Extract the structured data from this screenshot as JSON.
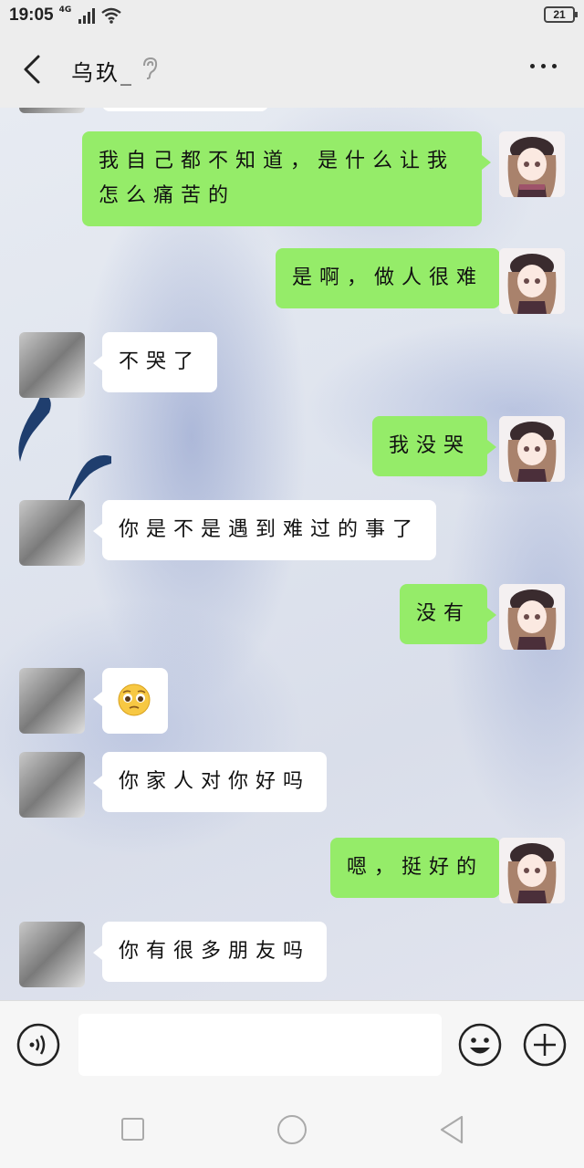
{
  "status_bar": {
    "time": "19:05",
    "network": "4G",
    "battery": "21"
  },
  "header": {
    "title": "乌玖_"
  },
  "messages": [
    {
      "sender": "self",
      "text": "我自己都不知道，是什么让我怎么痛苦的"
    },
    {
      "sender": "self",
      "text": "是啊，做人很难"
    },
    {
      "sender": "other",
      "text": "不哭了"
    },
    {
      "sender": "self",
      "text": "我没哭"
    },
    {
      "sender": "other",
      "text": "你是不是遇到难过的事了"
    },
    {
      "sender": "self",
      "text": "没有"
    },
    {
      "sender": "other",
      "emoji": "pleading-face"
    },
    {
      "sender": "other",
      "text": "你家人对你好吗"
    },
    {
      "sender": "self",
      "text": "嗯，挺好的"
    },
    {
      "sender": "other",
      "text": "你有很多朋友吗"
    }
  ],
  "input": {
    "value": ""
  },
  "icons": {
    "back": "chevron-left-icon",
    "ear": "ear-icon",
    "more": "more-dots-icon",
    "voice": "voice-icon",
    "emoji": "emoji-icon",
    "plus": "plus-icon"
  },
  "colors": {
    "self_bubble": "#95ec69",
    "other_bubble": "#ffffff",
    "header_bg": "#ededed"
  }
}
